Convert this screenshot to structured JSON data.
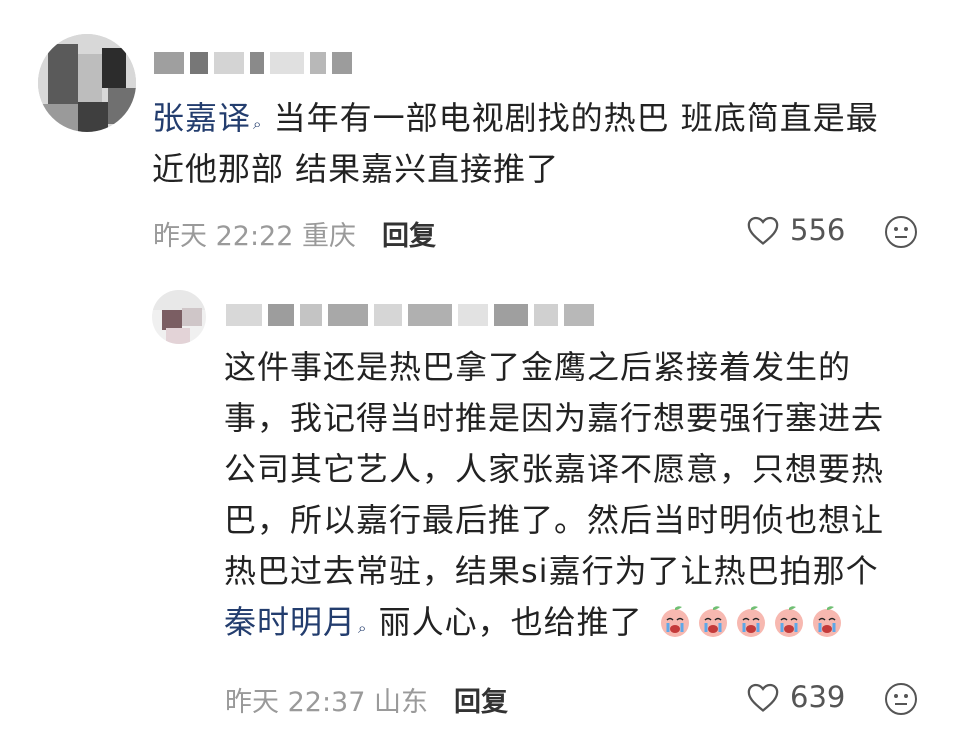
{
  "comment1": {
    "mention": "张嘉译",
    "content_after": "当年有一部电视剧找的热巴 班底简直是最",
    "content_line2": "近他那部 结果嘉兴直接推了",
    "meta": "昨天 22:22 重庆",
    "reply_label": "回复",
    "likes": "556"
  },
  "reply1": {
    "lines": [
      "这件事还是热巴拿了金鹰之后紧接着发生的",
      "事，我记得当时推是因为嘉行想要强行塞进去",
      "公司其它艺人，人家张嘉译不愿意，只想要热",
      "巴，所以嘉行最后推了。然后当时明侦也想让",
      "热巴过去常驻，结果si嘉行为了让热巴拍那个"
    ],
    "mention": "秦时明月",
    "last_line_after": "丽人心，也给推了",
    "meta": "昨天 22:37 山东",
    "reply_label": "回复",
    "likes": "639"
  },
  "icons": {
    "heart": "heart-outline-icon",
    "face": "neutral-face-icon",
    "emoji": "crying-peach-emoji"
  },
  "colors": {
    "mention": "#233d6e",
    "meta": "#9a9a9a"
  }
}
